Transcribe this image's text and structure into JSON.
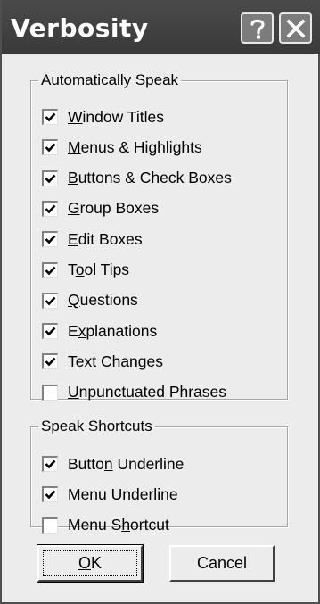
{
  "window": {
    "title": "Verbosity"
  },
  "titlebar": {
    "help_icon": "question-mark",
    "close_icon": "x-close"
  },
  "groups": [
    {
      "legend": "Automatically Speak",
      "items": [
        {
          "pre": "",
          "ul": "W",
          "post": "indow Titles",
          "checked": true
        },
        {
          "pre": "",
          "ul": "M",
          "post": "enus & Highlights",
          "checked": true
        },
        {
          "pre": "",
          "ul": "B",
          "post": "uttons & Check Boxes",
          "checked": true
        },
        {
          "pre": "",
          "ul": "G",
          "post": "roup Boxes",
          "checked": true
        },
        {
          "pre": "",
          "ul": "E",
          "post": "dit Boxes",
          "checked": true
        },
        {
          "pre": "T",
          "ul": "o",
          "post": "ol Tips",
          "checked": true
        },
        {
          "pre": "",
          "ul": "Q",
          "post": "uestions",
          "checked": true
        },
        {
          "pre": "E",
          "ul": "x",
          "post": "planations",
          "checked": true
        },
        {
          "pre": "",
          "ul": "T",
          "post": "ext Changes",
          "checked": true
        },
        {
          "pre": "",
          "ul": "U",
          "post": "npunctuated Phrases",
          "checked": false
        }
      ]
    },
    {
      "legend": "Speak Shortcuts",
      "items": [
        {
          "pre": "Butto",
          "ul": "n",
          "post": " Underline",
          "checked": true
        },
        {
          "pre": "Menu Un",
          "ul": "d",
          "post": "erline",
          "checked": true
        },
        {
          "pre": "Menu S",
          "ul": "h",
          "post": "ortcut",
          "checked": false
        }
      ]
    }
  ],
  "buttons": {
    "ok": {
      "ul": "O",
      "post": "K"
    },
    "cancel": {
      "label": "Cancel"
    }
  }
}
